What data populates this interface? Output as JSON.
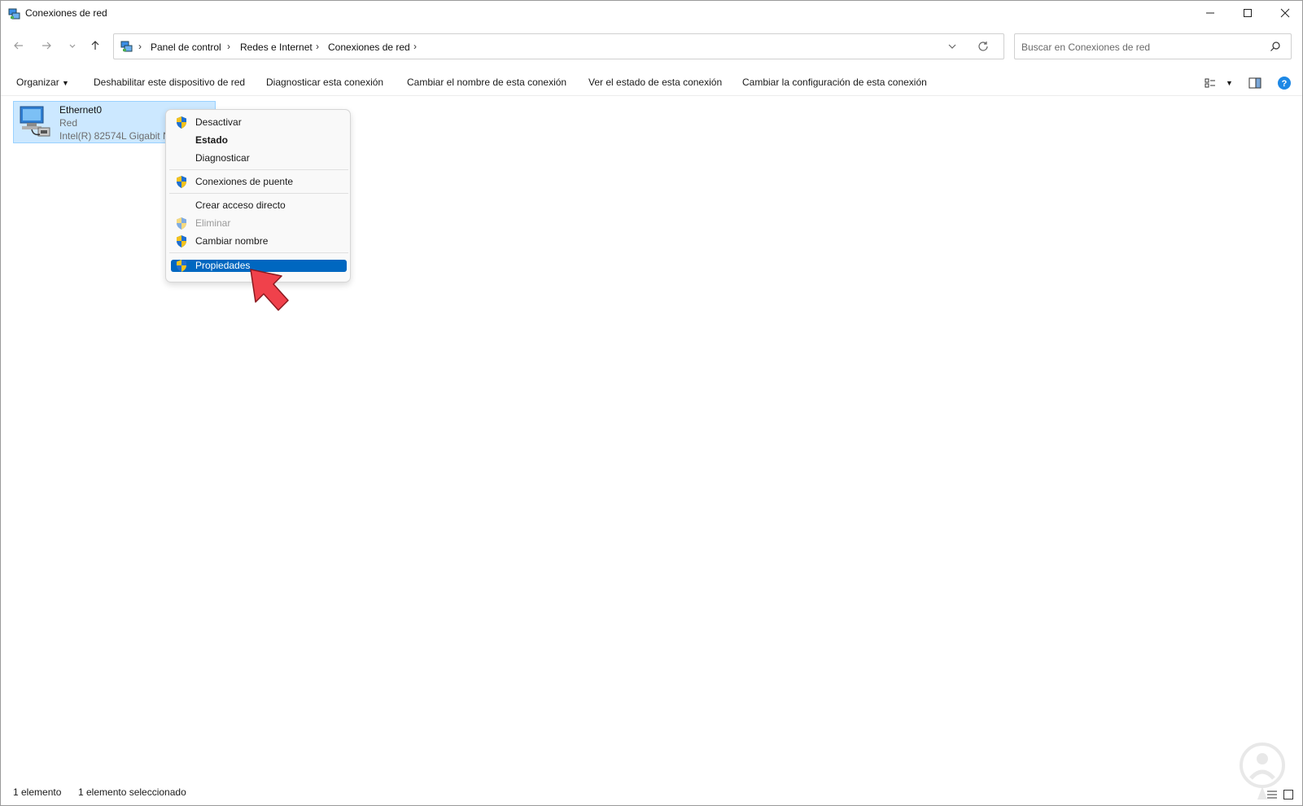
{
  "window": {
    "title": "Conexiones de red"
  },
  "address_bar": {
    "crumbs": [
      "Panel de control",
      "Redes e Internet",
      "Conexiones de red"
    ]
  },
  "search": {
    "placeholder": "Buscar en Conexiones de red"
  },
  "command_bar": {
    "organize": "Organizar",
    "disable_device": "Deshabilitar este dispositivo de red",
    "diagnose": "Diagnosticar esta conexión",
    "rename": "Cambiar el nombre de esta conexión",
    "view_status": "Ver el estado de esta conexión",
    "change_settings": "Cambiar la configuración de esta conexión"
  },
  "connection": {
    "name": "Ethernet0",
    "type": "Red",
    "device": "Intel(R) 82574L Gigabit N"
  },
  "context_menu": {
    "items": [
      {
        "label": "Desactivar",
        "shield": true
      },
      {
        "label": "Estado",
        "bold": true
      },
      {
        "label": "Diagnosticar"
      },
      {
        "label": "Conexiones de puente",
        "shield": true
      },
      {
        "label": "Crear acceso directo"
      },
      {
        "label": "Eliminar",
        "shield": true,
        "disabled": true
      },
      {
        "label": "Cambiar nombre",
        "shield": true
      },
      {
        "label": "Propiedades",
        "shield": true,
        "selected": true
      }
    ]
  },
  "status_bar": {
    "count": "1 elemento",
    "selected": "1 elemento seleccionado"
  },
  "colors": {
    "selection_bg": "#cce8ff",
    "menu_highlight": "#0067c0",
    "annotation_arrow": "#f0414b",
    "help_blue": "#1e88e5"
  }
}
